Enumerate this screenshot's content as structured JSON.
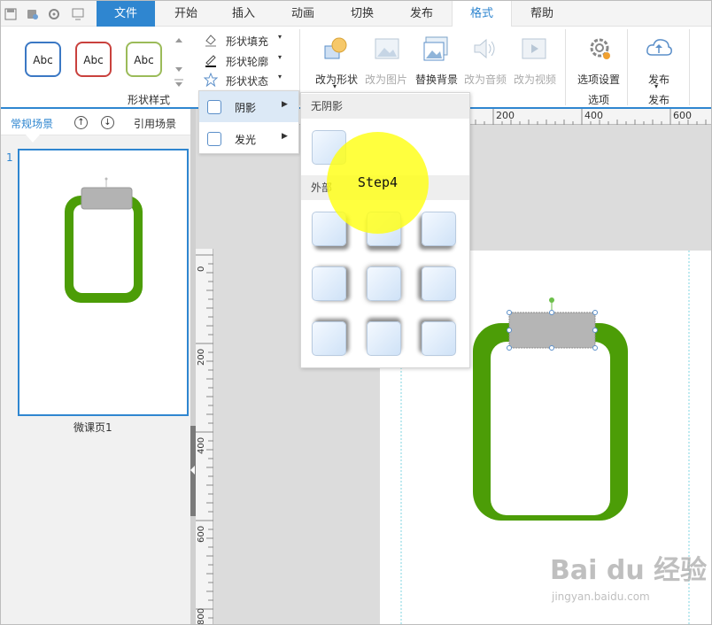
{
  "tabs": {
    "file": "文件",
    "home": "开始",
    "insert": "插入",
    "animation": "动画",
    "transition": "切换",
    "publish": "发布",
    "format": "格式",
    "help": "帮助"
  },
  "ribbon": {
    "style_sample": "Abc",
    "shape_style_label": "形状样式",
    "fill": "形状填充",
    "outline": "形状轮廓",
    "state": "形状状态",
    "change_shape": "改为形状",
    "change_image": "改为图片",
    "replace_bg": "替换背景",
    "change_audio": "改为音频",
    "change_video": "改为视频",
    "option_settings": "选项设置",
    "options_group": "选项",
    "publish_btn": "发布",
    "publish_group": "发布"
  },
  "scene_panel": {
    "normal_scene": "常规场景",
    "ref_scene": "引用场景",
    "slide_number": "1",
    "slide_name": "微课页1"
  },
  "effects_menu": {
    "shadow": "阴影",
    "glow": "发光"
  },
  "shadow_menu": {
    "no_shadow": "无阴影",
    "outer": "外部"
  },
  "ruler": {
    "top_ticks": [
      "200",
      "400",
      "600"
    ],
    "left_ticks": [
      "0",
      "200",
      "400",
      "600",
      "800"
    ]
  },
  "callout": "Step4",
  "watermark": {
    "logo": "Bai du 经验",
    "url": "jingyan.baidu.com"
  },
  "colors": {
    "accent": "#2f86d0",
    "shape_green": "#4c9d07",
    "highlight": "#ffff14"
  }
}
